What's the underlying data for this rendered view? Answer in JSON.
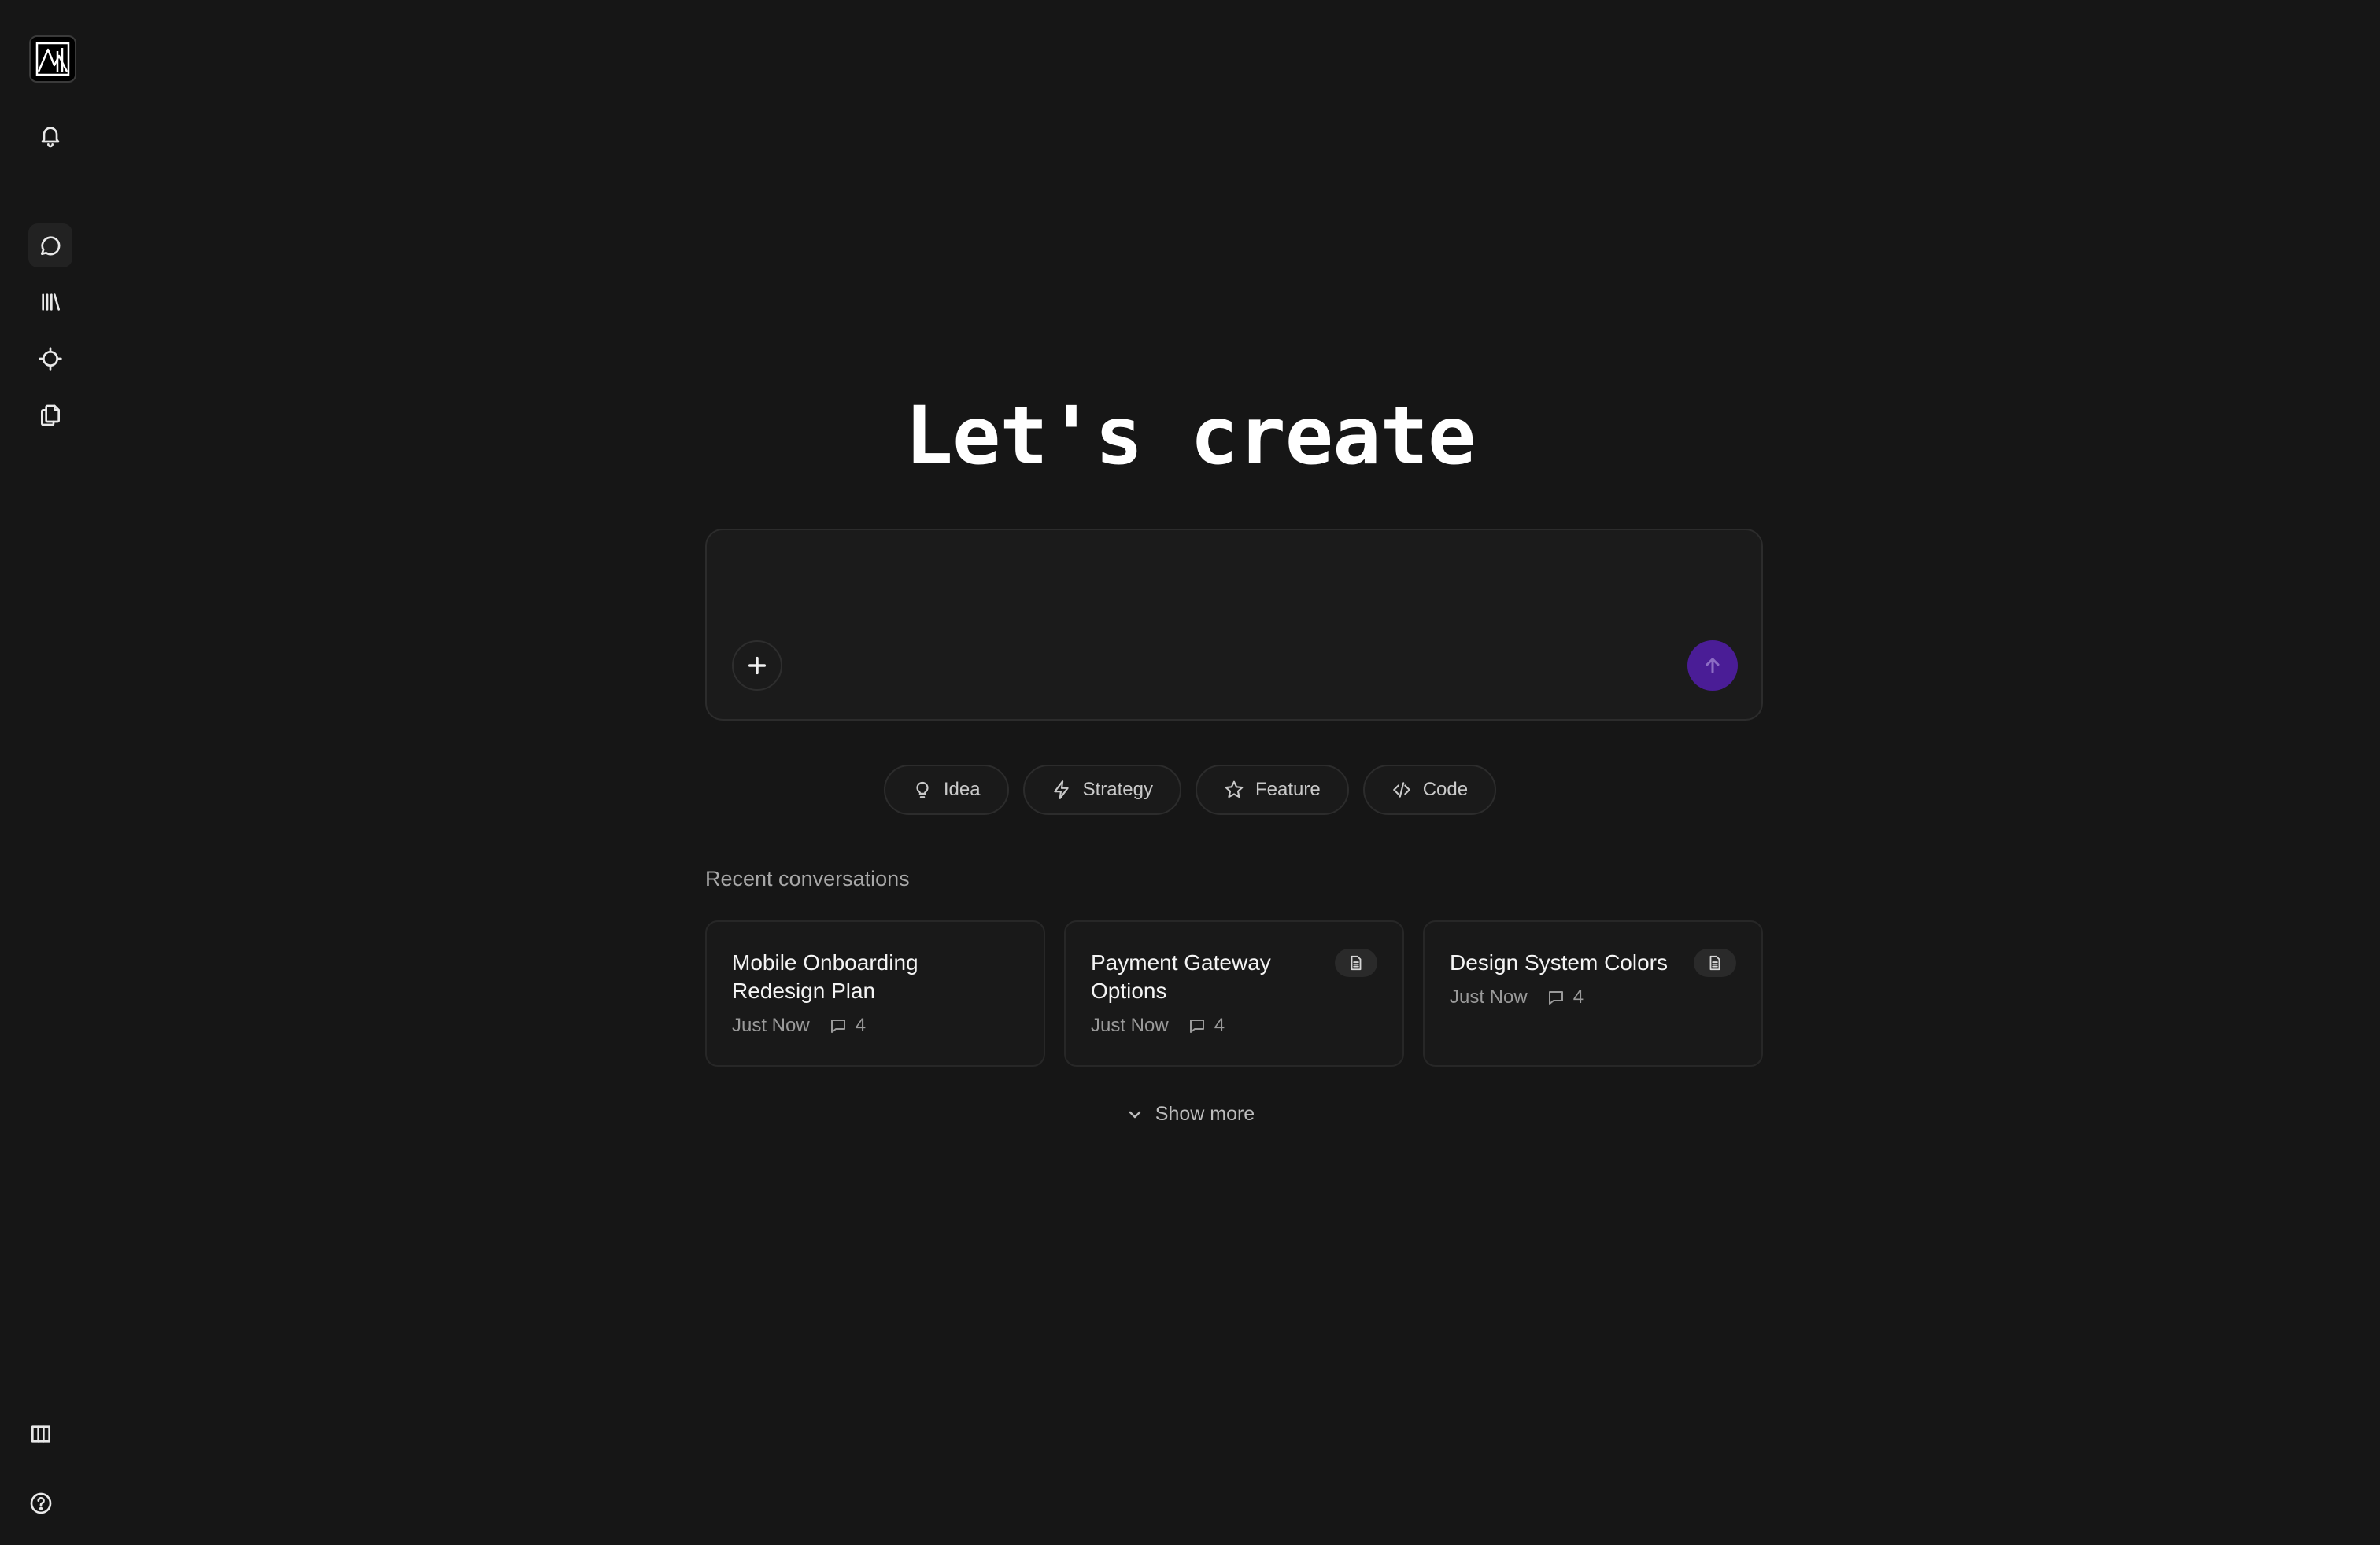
{
  "app": {
    "accent_color": "#4a1d96",
    "background_color": "#161616"
  },
  "sidebar": {
    "logo_icon": "mountain-chart-logo",
    "top_items": [
      {
        "icon": "bell-icon"
      }
    ],
    "nav_items": [
      {
        "icon": "chat-bubble-icon",
        "active": true
      },
      {
        "icon": "library-icon",
        "active": false
      },
      {
        "icon": "crosshair-icon",
        "active": false
      },
      {
        "icon": "documents-icon",
        "active": false
      }
    ],
    "bottom_items": [
      {
        "icon": "columns-layout-icon"
      },
      {
        "icon": "help-circle-icon"
      }
    ]
  },
  "hero": {
    "title": "Let's create"
  },
  "composer": {
    "input_value": "",
    "add_icon": "plus-icon",
    "send_icon": "arrow-up-icon"
  },
  "chips": [
    {
      "label": "Idea",
      "icon": "lightbulb-icon"
    },
    {
      "label": "Strategy",
      "icon": "lightning-icon"
    },
    {
      "label": "Feature",
      "icon": "star-icon"
    },
    {
      "label": "Code",
      "icon": "code-icon"
    }
  ],
  "recent": {
    "label": "Recent conversations",
    "cards": [
      {
        "title": "Mobile Onboarding Redesign Plan",
        "time": "Just Now",
        "count": "4",
        "has_doc": false
      },
      {
        "title": "Payment Gateway Options",
        "time": "Just Now",
        "count": "4",
        "has_doc": true
      },
      {
        "title": "Design System Colors",
        "time": "Just Now",
        "count": "4",
        "has_doc": true
      }
    ],
    "show_more": "Show more"
  }
}
